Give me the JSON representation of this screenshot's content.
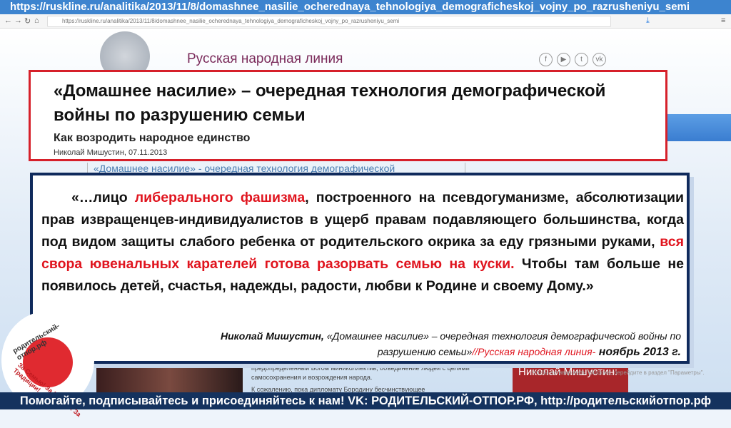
{
  "banner_url": "https://ruskline.ru/analitika/2013/11/8/domashnee_nasilie_ocherednaya_tehnologiya_demograficheskoj_vojny_po_razrusheniyu_semi",
  "browser": {
    "address": "https://ruskline.ru/analitika/2013/11/8/domashnee_nasilie_ocherednaya_tehnologiya_demograficheskoj_vojny_po_razrusheniyu_semi"
  },
  "site": {
    "name": "Русская народная линия",
    "social": [
      "f",
      "▶",
      "t",
      "vk"
    ]
  },
  "article": {
    "title": "«Домашнее насилие» – очередная технология демографической войны по разрушению семьи",
    "subtitle": "Как возродить народное единство",
    "byline": "Николай Мишустин, 07.11.2013",
    "bg_link": "«Домашнее насилие» - очередная технология демографической"
  },
  "quote": {
    "p1": "«…лицо ",
    "r1": "либерального фашизма",
    "p2": ", построенного на псевдогуманизме, абсолютизации прав извращенцев-индивидуалистов в ущерб правам подавляющего большинства, когда под видом защиты слабого ребенка от родительского окрика за еду грязными руками, ",
    "r2": "вся свора ювенальных карателей готова разорвать семью на куски.",
    "p3": " Чтобы там больше не появилось детей, счастья, надежды, радости, любви к Родине и своему Дому.»"
  },
  "citation": {
    "author": "Николай Мишустин,",
    "work": " «Домашнее насилие» – очередная технология демографической войны по разрушению семьи»",
    "source": "//Русская народная линия-",
    "date": " ноябрь 2013 г."
  },
  "background": {
    "text1": "предопределенный Богом миниколлектив, объединение людей с целями самосохранения и возрождения народа.",
    "text2": "К сожалению, пока дипломату Бородину бесчинствующее",
    "card": "Николай Мишустин:",
    "windows": "Чтобы активировать Windows, перейдите в раздел \"Параметры\"."
  },
  "stamp": {
    "top": "родительский-отпор.рф",
    "bottom": "За Семью! За Родину! За Традиции!"
  },
  "footer": "Помогайте, подписывайтесь и присоединяйтесь к нам! VK: РОДИТЕЛЬСКИЙ-ОТПОР.РФ, http://родительскийотпор.рф"
}
